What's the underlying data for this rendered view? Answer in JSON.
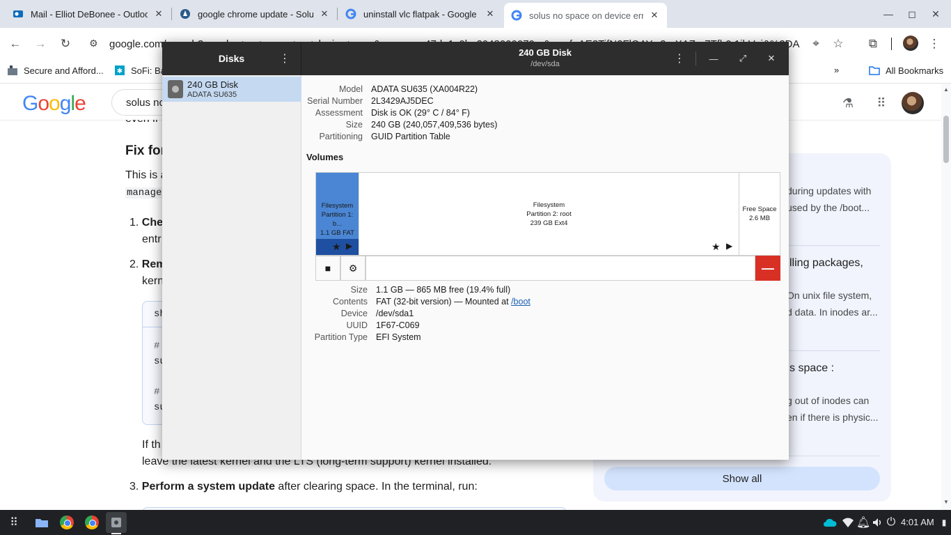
{
  "tabs": [
    {
      "title": "Mail - Elliot DeBonee - Outlook",
      "icon": "outlook-icon"
    },
    {
      "title": "google chrome update - Solus",
      "icon": "solus-icon"
    },
    {
      "title": "uninstall vlc flatpak - Google S",
      "icon": "google-icon"
    },
    {
      "title": "solus no space on device error",
      "icon": "google-icon",
      "active": true
    }
  ],
  "toolbar": {
    "url": "google.com/search?q=solus+no+space+on+device+error&sca_esv=47de1c0b_2048000070...&sxsrf=AE3TifN2FlQAY...2a-XAZe-7Tfb0:1ibVuj&%2DA"
  },
  "bookmarks": [
    {
      "label": "Secure and Afford..."
    },
    {
      "label": "SoFi: Ba"
    }
  ],
  "bookmarks_right": {
    "label": "All Bookmarks"
  },
  "google": {
    "logo": "Google",
    "search_value": "solus no",
    "cut_line": "even if",
    "heading": "Fix for",
    "para_line1": "This is a",
    "para_line2": "manage",
    "step1_bold": "Che",
    "step1_rest": "entr",
    "step2_bold": "Rem",
    "step2_rest": "kern",
    "code_tab": "sh",
    "code_l1": "#",
    "code_l2": "su",
    "code_l3": "#",
    "code_l4": "su",
    "after_code_l1": "If th",
    "after_code_l2": "leave the latest kernel and the LTS (long-term support) kernel installed.",
    "step3_bold": "Perform a system update",
    "step3_rest": " after clearing space. In the terminal, run:",
    "ai": {
      "p1_l1": "during updates with",
      "p1_l2": "used by the /boot...",
      "h2": "lling packages,",
      "p2_l1": "On unix file system,",
      "p2_l2": "d data. In inodes ar...",
      "h3": "s space :",
      "p3_l1": "g out of inodes can",
      "p3_l2": "en if there is physic...",
      "show_all": "Show all"
    }
  },
  "disks": {
    "app_title": "Disks",
    "sidebar": [
      {
        "name": "240 GB Disk",
        "model": "ADATA SU635"
      }
    ],
    "title": "240 GB Disk",
    "subtitle": "/dev/sda",
    "info": [
      {
        "key": "Model",
        "value": "ADATA SU635 (XA004R22)"
      },
      {
        "key": "Serial Number",
        "value": "2L3429AJ5DEC"
      },
      {
        "key": "Assessment",
        "value": "Disk is OK (29° C / 84° F)"
      },
      {
        "key": "Size",
        "value": "240 GB (240,057,409,536 bytes)"
      },
      {
        "key": "Partitioning",
        "value": "GUID Partition Table"
      }
    ],
    "volumes_label": "Volumes",
    "partitions": [
      {
        "l1": "Filesystem",
        "l2": "Partition 1: b...",
        "l3": "1.1 GB FAT"
      },
      {
        "l1": "Filesystem",
        "l2": "Partition 2: root",
        "l3": "239 GB Ext4"
      },
      {
        "l1": "Free Space",
        "l2": "2.6 MB"
      }
    ],
    "details": [
      {
        "key": "Size",
        "value": "1.1 GB — 865 MB free (19.4% full)"
      },
      {
        "key": "Contents",
        "value": "FAT (32-bit version) — Mounted at ",
        "link": "/boot"
      },
      {
        "key": "Device",
        "value": "/dev/sda1"
      },
      {
        "key": "UUID",
        "value": "1F67-C069"
      },
      {
        "key": "Partition Type",
        "value": "EFI System"
      }
    ]
  },
  "shelf": {
    "time": "4:01 AM"
  },
  "colors": {
    "accent": "#1a73e8",
    "partition_selected": "#4a86d4",
    "delete": "#d93025"
  }
}
